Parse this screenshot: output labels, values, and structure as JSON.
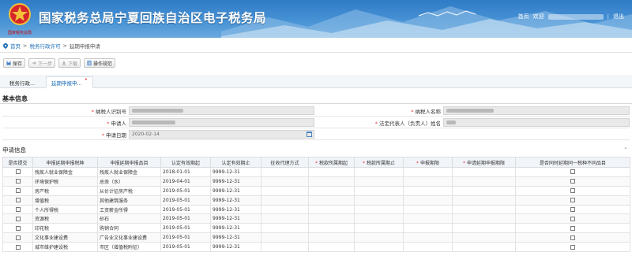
{
  "header": {
    "emblem_text": "国家税务总局",
    "title": "国家税务总局宁夏回族自治区电子税务局",
    "home_label": "首页",
    "welcome_label": "欢迎",
    "separator": "|",
    "logout_label": "退出"
  },
  "breadcrumb": {
    "items": [
      "首页",
      "税务行政许可",
      "延期申报申请"
    ],
    "separator": ">"
  },
  "toolbar": {
    "save_label": "保存",
    "next_label": "下一步",
    "download_label": "下载",
    "guide_label": "操作规范"
  },
  "tabs": [
    {
      "label": "税务行政..."
    },
    {
      "label": "延期申报申..."
    }
  ],
  "basic_info": {
    "title": "基本信息",
    "taxpayer_id_label": "纳税人识别号",
    "taxpayer_name_label": "纳税人名称",
    "applicant_label": "申请人",
    "legal_rep_label": "法定代表人（负责人）姓名",
    "apply_date_label": "申请日期",
    "apply_date_value": "2020-02-14"
  },
  "apply_info": {
    "title": "申请信息",
    "columns": [
      {
        "label": "是否提交",
        "required": false
      },
      {
        "label": "申报延期申报税种",
        "required": false
      },
      {
        "label": "申报延期申报品目",
        "required": false
      },
      {
        "label": "认定有效期起",
        "required": false
      },
      {
        "label": "认定有效期止",
        "required": false
      },
      {
        "label": "征收代理方式",
        "required": false
      },
      {
        "label": "税款所属期起",
        "required": true
      },
      {
        "label": "税款所属期止",
        "required": true
      },
      {
        "label": "申报期限",
        "required": true
      },
      {
        "label": "申请延期申报期限",
        "required": true
      },
      {
        "label": "是否同时延期同一税种不同品目",
        "required": false
      }
    ],
    "rows": [
      {
        "tax": "残疾人就业保障金",
        "item": "残疾人就业保障金",
        "start": "2018-01-01",
        "end": "9999-12-31"
      },
      {
        "tax": "环境保护税",
        "item": "总汞（水）",
        "start": "2019-04-01",
        "end": "9999-12-31"
      },
      {
        "tax": "房产税",
        "item": "从价计征房产税",
        "start": "2019-05-01",
        "end": "9999-12-31"
      },
      {
        "tax": "增值税",
        "item": "其他建筑服务",
        "start": "2019-05-01",
        "end": "9999-12-31"
      },
      {
        "tax": "个人所得税",
        "item": "工资薪金所得",
        "start": "2019-05-01",
        "end": "9999-12-31"
      },
      {
        "tax": "资源税",
        "item": "砂石",
        "start": "2019-05-01",
        "end": "9999-12-31"
      },
      {
        "tax": "印花税",
        "item": "购销合同",
        "start": "2019-05-01",
        "end": "9999-12-31"
      },
      {
        "tax": "文化事业建设费",
        "item": "广告业文化事业建设费",
        "start": "2019-05-01",
        "end": "9999-12-31"
      },
      {
        "tax": "城市维护建设税",
        "item": "市区（增值税附征）",
        "start": "2019-05-01",
        "end": "9999-12-31"
      }
    ]
  },
  "colors": {
    "banner": "#2f7bc6",
    "link": "#1f6fb8",
    "required": "#e23b3b"
  }
}
